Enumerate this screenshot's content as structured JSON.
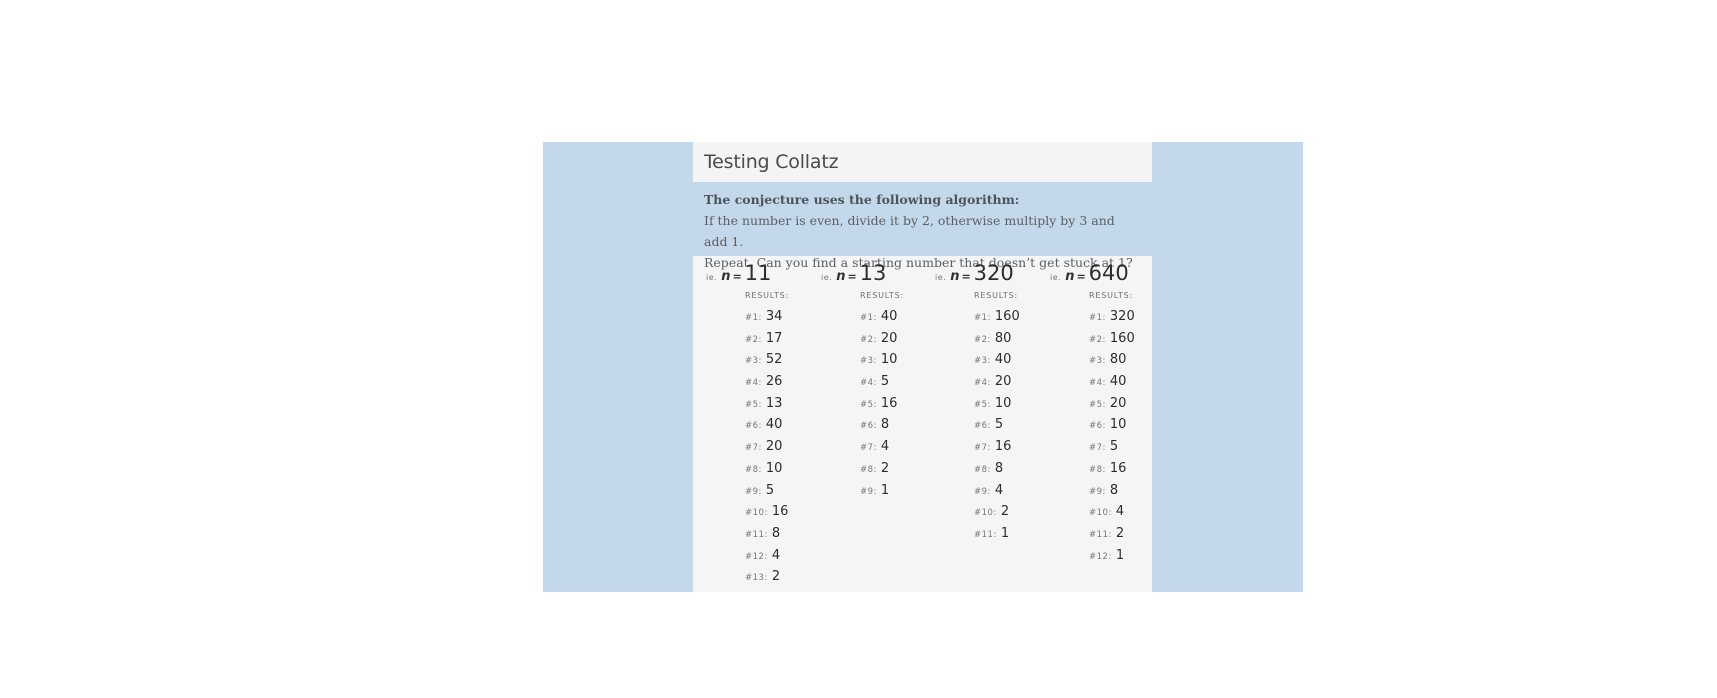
{
  "page": {
    "title": "Testing Collatz",
    "intro_lead": "The conjecture uses the following algorithm:",
    "intro_line1": "If the number is even, divide it by 2, otherwise multiply by 3 and add 1.",
    "intro_line2": "Repeat. Can you find a starting number that doesn’t get stuck at 1?"
  },
  "columns": [
    {
      "ie": "ie.",
      "n_var": "n",
      "eq": "=",
      "n_value": "11",
      "results_label": "RESULTS:",
      "results": [
        {
          "idx": "#1:",
          "val": "34"
        },
        {
          "idx": "#2:",
          "val": "17"
        },
        {
          "idx": "#3:",
          "val": "52"
        },
        {
          "idx": "#4:",
          "val": "26"
        },
        {
          "idx": "#5:",
          "val": "13"
        },
        {
          "idx": "#6:",
          "val": "40"
        },
        {
          "idx": "#7:",
          "val": "20"
        },
        {
          "idx": "#8:",
          "val": "10"
        },
        {
          "idx": "#9:",
          "val": "5"
        },
        {
          "idx": "#10:",
          "val": "16"
        },
        {
          "idx": "#11:",
          "val": "8"
        },
        {
          "idx": "#12:",
          "val": "4"
        },
        {
          "idx": "#13:",
          "val": "2"
        }
      ]
    },
    {
      "ie": "ie.",
      "n_var": "n",
      "eq": "=",
      "n_value": "13",
      "results_label": "RESULTS:",
      "results": [
        {
          "idx": "#1:",
          "val": "40"
        },
        {
          "idx": "#2:",
          "val": "20"
        },
        {
          "idx": "#3:",
          "val": "10"
        },
        {
          "idx": "#4:",
          "val": "5"
        },
        {
          "idx": "#5:",
          "val": "16"
        },
        {
          "idx": "#6:",
          "val": "8"
        },
        {
          "idx": "#7:",
          "val": "4"
        },
        {
          "idx": "#8:",
          "val": "2"
        },
        {
          "idx": "#9:",
          "val": "1"
        }
      ]
    },
    {
      "ie": "ie.",
      "n_var": "n",
      "eq": "=",
      "n_value": "320",
      "results_label": "RESULTS:",
      "results": [
        {
          "idx": "#1:",
          "val": "160"
        },
        {
          "idx": "#2:",
          "val": "80"
        },
        {
          "idx": "#3:",
          "val": "40"
        },
        {
          "idx": "#4:",
          "val": "20"
        },
        {
          "idx": "#5:",
          "val": "10"
        },
        {
          "idx": "#6:",
          "val": "5"
        },
        {
          "idx": "#7:",
          "val": "16"
        },
        {
          "idx": "#8:",
          "val": "8"
        },
        {
          "idx": "#9:",
          "val": "4"
        },
        {
          "idx": "#10:",
          "val": "2"
        },
        {
          "idx": "#11:",
          "val": "1"
        }
      ]
    },
    {
      "ie": "ie.",
      "n_var": "n",
      "eq": "=",
      "n_value": "640",
      "results_label": "RESULTS:",
      "results": [
        {
          "idx": "#1:",
          "val": "320"
        },
        {
          "idx": "#2:",
          "val": "160"
        },
        {
          "idx": "#3:",
          "val": "80"
        },
        {
          "idx": "#4:",
          "val": "40"
        },
        {
          "idx": "#5:",
          "val": "20"
        },
        {
          "idx": "#6:",
          "val": "10"
        },
        {
          "idx": "#7:",
          "val": "5"
        },
        {
          "idx": "#8:",
          "val": "16"
        },
        {
          "idx": "#9:",
          "val": "8"
        },
        {
          "idx": "#10:",
          "val": "4"
        },
        {
          "idx": "#11:",
          "val": "2"
        },
        {
          "idx": "#12:",
          "val": "1"
        }
      ]
    }
  ]
}
